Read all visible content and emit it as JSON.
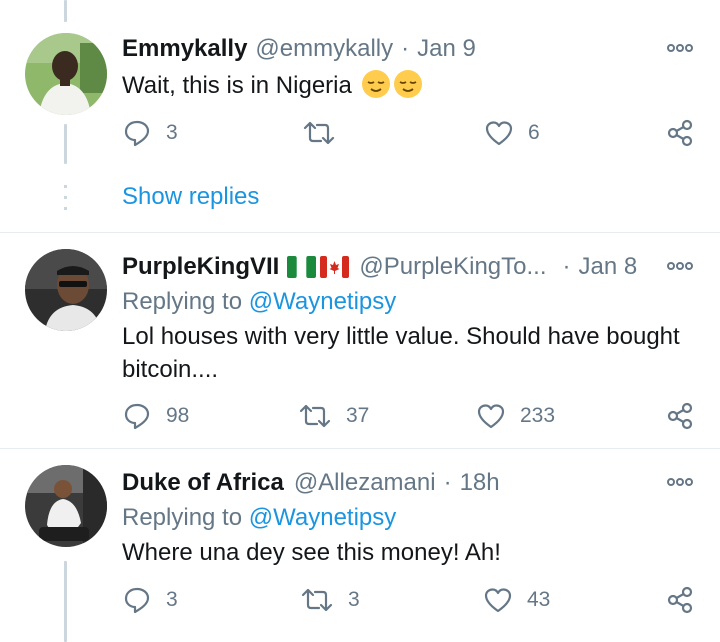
{
  "colors": {
    "accent": "#1b95e0",
    "secondary_text": "#657786",
    "primary_text": "#14171a",
    "thread_line": "#ccd6dd",
    "divider": "#e6ecf0"
  },
  "thread": {
    "show_replies_label": "Show replies"
  },
  "tweets": [
    {
      "name": "Emmykally",
      "handle": "@emmykally",
      "separator": "·",
      "date": "Jan 9",
      "text": "Wait, this is in Nigeria",
      "emojis": [
        "relieved-face-emoji",
        "relieved-face-emoji"
      ],
      "replies": "3",
      "retweets": "",
      "likes": "6"
    },
    {
      "name": "PurpleKingVII",
      "flags": [
        "nigeria-flag",
        "canada-flag"
      ],
      "handle": "@PurpleKingTo...",
      "separator": "·",
      "date": "Jan 8",
      "replying_prefix": "Replying to",
      "replying_to": "@Waynetipsy",
      "text": "Lol houses with very little value. Should have bought bitcoin....",
      "replies": "98",
      "retweets": "37",
      "likes": "233"
    },
    {
      "name": "Duke of Africa",
      "handle": "@Allezamani",
      "separator": "·",
      "date": "18h",
      "replying_prefix": "Replying to",
      "replying_to": "@Waynetipsy",
      "text": "Where una dey see this money! Ah!",
      "replies": "3",
      "retweets": "3",
      "likes": "43"
    }
  ]
}
